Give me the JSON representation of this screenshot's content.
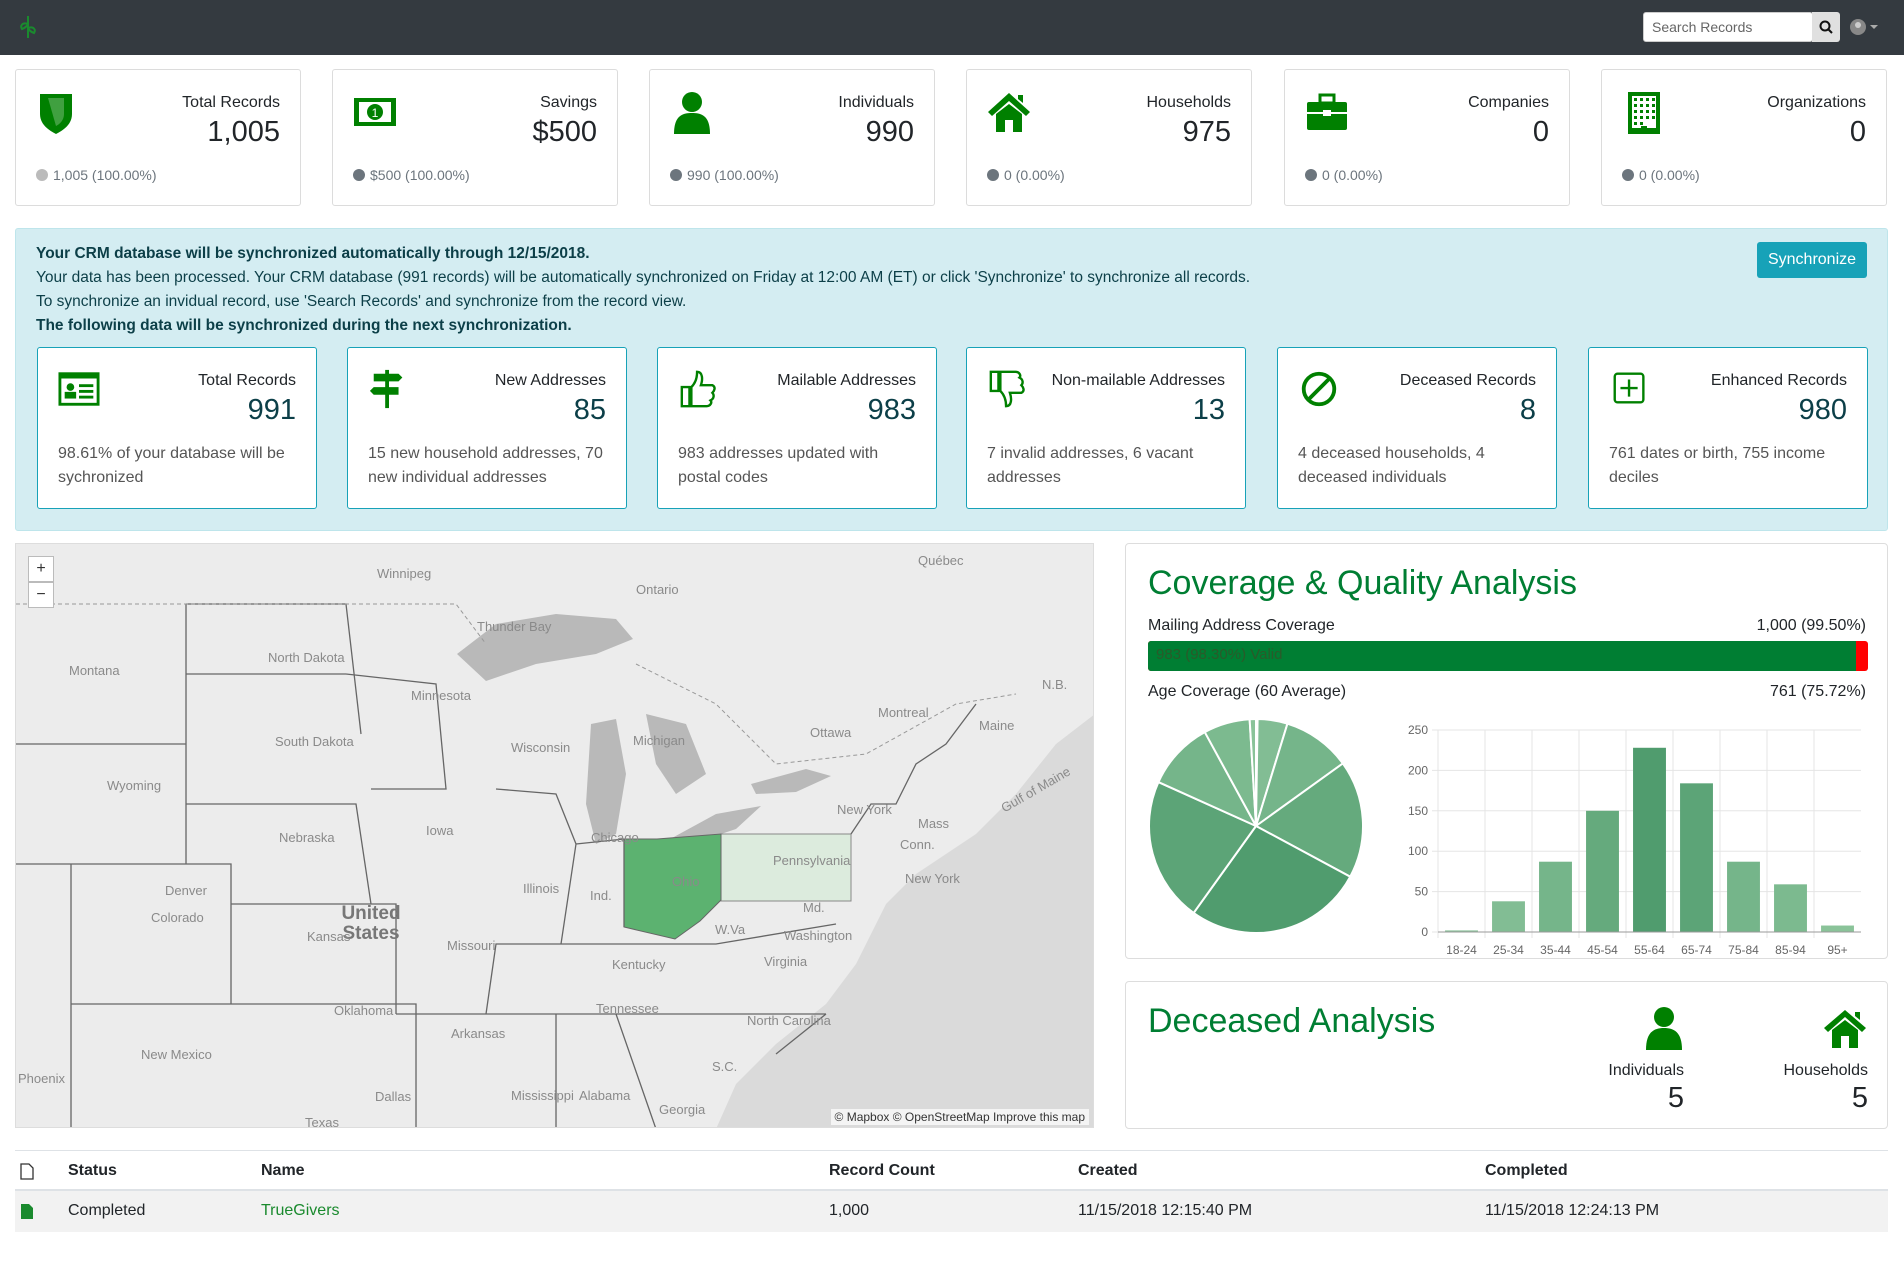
{
  "nav": {
    "search_placeholder": "Search Records",
    "icons": [
      "logo-leaf-icon",
      "search-icon",
      "user-icon"
    ]
  },
  "stats": [
    {
      "label": "Total Records",
      "value": "1,005",
      "foot": "1,005 (100.00%)",
      "icon": "shield-icon",
      "dot": "#bbbbbb"
    },
    {
      "label": "Savings",
      "value": "$500",
      "foot": "$500 (100.00%)",
      "icon": "money-icon",
      "dot": "#6c757d"
    },
    {
      "label": "Individuals",
      "value": "990",
      "foot": "990 (100.00%)",
      "icon": "user-icon",
      "dot": "#6c757d"
    },
    {
      "label": "Households",
      "value": "975",
      "foot": "0 (0.00%)",
      "icon": "home-icon",
      "dot": "#6c757d"
    },
    {
      "label": "Companies",
      "value": "0",
      "foot": "0 (0.00%)",
      "icon": "briefcase-icon",
      "dot": "#6c757d"
    },
    {
      "label": "Organizations",
      "value": "0",
      "foot": "0 (0.00%)",
      "icon": "building-icon",
      "dot": "#6c757d"
    }
  ],
  "sync": {
    "line1": "Your CRM database will be synchronized automatically through 12/15/2018.",
    "line2": "Your data has been processed. Your CRM database (991 records) will be automatically synchronized on Friday at 12:00 AM (ET) or click 'Synchronize' to synchronize all records.",
    "line3": "To synchronize an invidual record, use 'Search Records' and synchronize from the record view.",
    "line4": "The following data will be synchronized  during the next synchronization.",
    "button": "Synchronize",
    "cards": [
      {
        "label": "Total Records",
        "value": "991",
        "desc": "98.61% of your database will be sychronized",
        "icon": "id-card-icon"
      },
      {
        "label": "New Addresses",
        "value": "85",
        "desc": "15 new household addresses, 70 new individual addresses",
        "icon": "signpost-icon"
      },
      {
        "label": "Mailable Addresses",
        "value": "983",
        "desc": "983 addresses updated with postal codes",
        "icon": "thumbs-up-icon"
      },
      {
        "label": "Non-mailable Addresses",
        "value": "13",
        "desc": "7 invalid addresses, 6 vacant addresses",
        "icon": "thumbs-down-icon"
      },
      {
        "label": "Deceased Records",
        "value": "8",
        "desc": "4 deceased households, 4 deceased individuals",
        "icon": "ban-icon"
      },
      {
        "label": "Enhanced Records",
        "value": "980",
        "desc": "761 dates or birth, 755 income deciles",
        "icon": "plus-square-icon"
      }
    ]
  },
  "map": {
    "zoom_in": "+",
    "zoom_out": "−",
    "attribution": "© Mapbox © OpenStreetMap Improve this map",
    "labels": [
      "Winnipeg",
      "Ontario",
      "Québec",
      "Thunder Bay",
      "North Dakota",
      "Montana",
      "Minnesota",
      "South Dakota",
      "Wisconsin",
      "Michigan",
      "Ottawa",
      "Montreal",
      "Maine",
      "N.B.",
      "Wyoming",
      "Nebraska",
      "Iowa",
      "Chicago",
      "New York",
      "Pennsylvania",
      "Ohio",
      "Illinois",
      "Ind.",
      "Denver",
      "Colorado",
      "United States",
      "Kansas",
      "Missouri",
      "W.Va",
      "Washington",
      "Kentucky",
      "Virginia",
      "Oklahoma",
      "Tennessee",
      "North Carolina",
      "Arkansas",
      "New Mexico",
      "S.C.",
      "Dallas",
      "Mississippi",
      "Alabama",
      "Georgia",
      "Texas",
      "Phoenix",
      "Gulf of Maine",
      "New York",
      "Conn.",
      "Mass",
      "Md."
    ],
    "highlight_color": "#5cb270"
  },
  "coverage": {
    "title": "Coverage & Quality Analysis",
    "mailing_label": "Mailing Address Coverage",
    "mailing_value": "1,000 (99.50%)",
    "bar_text": "983 (98.30%) Valid",
    "valid_percent": 98.3,
    "bar_color": "#007e33",
    "invalid_color": "#ff0000",
    "age_label": "Age Coverage (60 Average)",
    "age_value": "761 (75.72%)"
  },
  "chart_data": {
    "type": "bar",
    "categories": [
      "18-24",
      "25-34",
      "35-44",
      "45-54",
      "55-64",
      "65-74",
      "75-84",
      "85-94",
      "95+"
    ],
    "values": [
      2,
      38,
      87,
      150,
      228,
      184,
      87,
      59,
      8
    ],
    "ylim": [
      0,
      250
    ],
    "yticks": [
      0,
      50,
      100,
      150,
      200,
      250
    ],
    "grid": true,
    "pie_of_same_values": true,
    "color": "#2e9e5b"
  },
  "deceased": {
    "title": "Deceased Analysis",
    "individuals_label": "Individuals",
    "individuals_value": "5",
    "households_label": "Households",
    "households_value": "5"
  },
  "table": {
    "headers": [
      "Status",
      "Name",
      "Record Count",
      "Created",
      "Completed"
    ],
    "rows": [
      {
        "status": "Completed",
        "name": "TrueGivers",
        "count": "1,000",
        "created": "11/15/2018 12:15:40 PM",
        "completed": "11/15/2018 12:24:13 PM"
      }
    ]
  }
}
